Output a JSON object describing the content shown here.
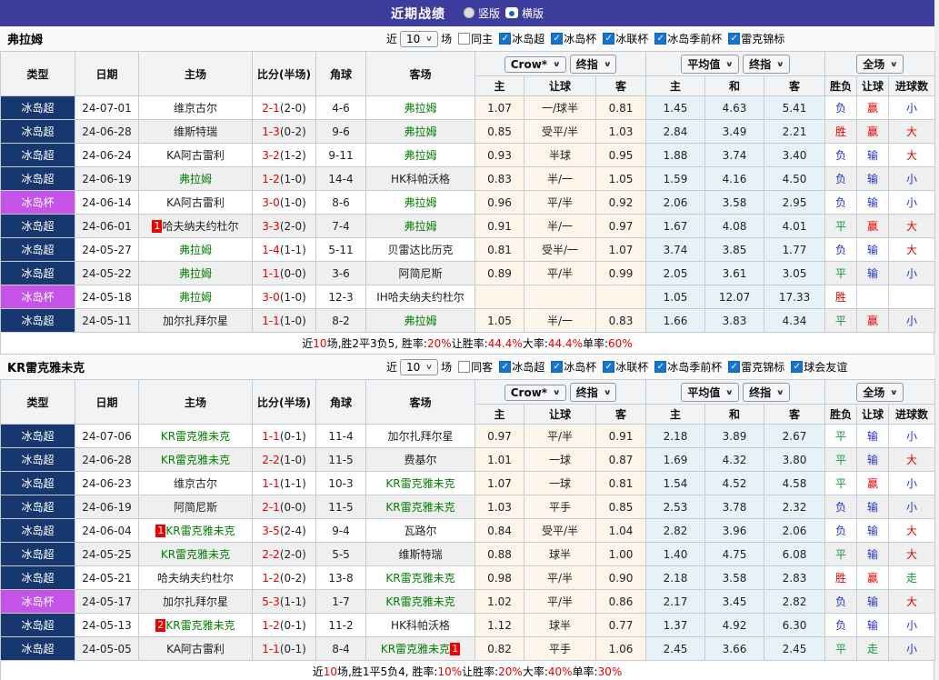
{
  "titlebar": {
    "title": "近期战绩",
    "radios": [
      {
        "label": "竖版",
        "selected": false
      },
      {
        "label": "横版",
        "selected": true
      }
    ]
  },
  "colors": {
    "titlebar_bg": "#3d3d9e",
    "league_super_bg": "#17386e",
    "league_cup_bg": "#c653e8",
    "team_highlight": "#008000",
    "score_red": "#e60000",
    "result_red": "#e60000",
    "result_blue": "#2233cc",
    "result_green": "#0a9a3c",
    "odds_bg": "#fdf5ea",
    "avg_bg": "#e7f2f8",
    "checkbox_blue": "#1673cf"
  },
  "table_headers": {
    "columns": [
      "类型",
      "日期",
      "主场",
      "比分(半场)",
      "角球",
      "客场"
    ],
    "selects": {
      "bookmaker": "Crow*",
      "final_a": "终指",
      "average": "平均值",
      "final_b": "终指",
      "fulltime": "全场"
    },
    "sub_odds": [
      "主",
      "让球",
      "客"
    ],
    "sub_avg": [
      "主",
      "和",
      "客"
    ],
    "sub_result": [
      "胜负",
      "让球",
      "进球数"
    ]
  },
  "sections": [
    {
      "team": "弗拉姆",
      "filter": {
        "prefix": "近",
        "count": "10",
        "suffix": "场",
        "same": {
          "label": "同主",
          "checked": false
        },
        "leagues": [
          {
            "label": "冰岛超",
            "checked": true
          },
          {
            "label": "冰岛杯",
            "checked": true
          },
          {
            "label": "冰联杯",
            "checked": true
          },
          {
            "label": "冰岛季前杯",
            "checked": true
          },
          {
            "label": "雷克锦标",
            "checked": true
          }
        ]
      },
      "rows": [
        {
          "lg": "冰岛超",
          "lgc": "navy",
          "date": "24-07-01",
          "home": "维京古尔",
          "hHL": false,
          "hB": "",
          "ft": "2-1",
          "ht": "(2-0)",
          "cor": "4-6",
          "away": "弗拉姆",
          "aHL": true,
          "aB": "",
          "o1": "1.07",
          "o2": "一/球半",
          "o3": "0.81",
          "a1": "1.45",
          "a2": "4.63",
          "a3": "5.41",
          "r1": [
            "负",
            "blue"
          ],
          "r2": [
            "赢",
            "red"
          ],
          "r3": [
            "小",
            "blue"
          ]
        },
        {
          "lg": "冰岛超",
          "lgc": "navy",
          "date": "24-06-28",
          "home": "维斯特瑞",
          "hHL": false,
          "hB": "",
          "ft": "1-3",
          "ht": "(0-2)",
          "cor": "9-6",
          "away": "弗拉姆",
          "aHL": true,
          "aB": "",
          "o1": "0.85",
          "o2": "受平/半",
          "o3": "1.03",
          "a1": "2.84",
          "a2": "3.49",
          "a3": "2.21",
          "r1": [
            "胜",
            "red"
          ],
          "r2": [
            "赢",
            "red"
          ],
          "r3": [
            "大",
            "red"
          ]
        },
        {
          "lg": "冰岛超",
          "lgc": "navy",
          "date": "24-06-24",
          "home": "KA阿古雷利",
          "hHL": false,
          "hB": "",
          "ft": "3-2",
          "ht": "(1-2)",
          "cor": "9-11",
          "away": "弗拉姆",
          "aHL": true,
          "aB": "",
          "o1": "0.93",
          "o2": "半球",
          "o3": "0.95",
          "a1": "1.88",
          "a2": "3.74",
          "a3": "3.40",
          "r1": [
            "负",
            "blue"
          ],
          "r2": [
            "输",
            "blue"
          ],
          "r3": [
            "大",
            "red"
          ]
        },
        {
          "lg": "冰岛超",
          "lgc": "navy",
          "date": "24-06-19",
          "home": "弗拉姆",
          "hHL": true,
          "hB": "",
          "ft": "1-2",
          "ht": "(1-0)",
          "cor": "14-4",
          "away": "HK科帕沃格",
          "aHL": false,
          "aB": "",
          "o1": "0.83",
          "o2": "半/一",
          "o3": "1.05",
          "a1": "1.59",
          "a2": "4.16",
          "a3": "4.50",
          "r1": [
            "负",
            "blue"
          ],
          "r2": [
            "输",
            "blue"
          ],
          "r3": [
            "小",
            "blue"
          ]
        },
        {
          "lg": "冰岛杯",
          "lgc": "violet",
          "date": "24-06-14",
          "home": "KA阿古雷利",
          "hHL": false,
          "hB": "",
          "ft": "3-0",
          "ht": "(1-0)",
          "cor": "8-6",
          "away": "弗拉姆",
          "aHL": true,
          "aB": "",
          "o1": "0.96",
          "o2": "平/半",
          "o3": "0.92",
          "a1": "2.06",
          "a2": "3.58",
          "a3": "2.95",
          "r1": [
            "负",
            "blue"
          ],
          "r2": [
            "输",
            "blue"
          ],
          "r3": [
            "小",
            "blue"
          ]
        },
        {
          "lg": "冰岛超",
          "lgc": "navy",
          "date": "24-06-01",
          "home": "哈夫纳夫约杜尔",
          "hHL": false,
          "hB": "1",
          "ft": "3-3",
          "ht": "(2-0)",
          "cor": "7-4",
          "away": "弗拉姆",
          "aHL": true,
          "aB": "",
          "o1": "0.91",
          "o2": "半/一",
          "o3": "0.97",
          "a1": "1.67",
          "a2": "4.08",
          "a3": "4.01",
          "r1": [
            "平",
            "green"
          ],
          "r2": [
            "赢",
            "red"
          ],
          "r3": [
            "大",
            "red"
          ]
        },
        {
          "lg": "冰岛超",
          "lgc": "navy",
          "date": "24-05-27",
          "home": "弗拉姆",
          "hHL": true,
          "hB": "",
          "ft": "1-4",
          "ht": "(1-1)",
          "cor": "5-11",
          "away": "贝雷达比历克",
          "aHL": false,
          "aB": "",
          "o1": "0.81",
          "o2": "受半/一",
          "o3": "1.07",
          "a1": "3.74",
          "a2": "3.85",
          "a3": "1.77",
          "r1": [
            "负",
            "blue"
          ],
          "r2": [
            "输",
            "blue"
          ],
          "r3": [
            "大",
            "red"
          ]
        },
        {
          "lg": "冰岛超",
          "lgc": "navy",
          "date": "24-05-22",
          "home": "弗拉姆",
          "hHL": true,
          "hB": "",
          "ft": "1-1",
          "ht": "(0-0)",
          "cor": "3-6",
          "away": "阿简尼斯",
          "aHL": false,
          "aB": "",
          "o1": "0.89",
          "o2": "平/半",
          "o3": "0.99",
          "a1": "2.05",
          "a2": "3.61",
          "a3": "3.05",
          "r1": [
            "平",
            "green"
          ],
          "r2": [
            "输",
            "blue"
          ],
          "r3": [
            "小",
            "blue"
          ]
        },
        {
          "lg": "冰岛杯",
          "lgc": "violet",
          "date": "24-05-18",
          "home": "弗拉姆",
          "hHL": true,
          "hB": "",
          "ft": "3-0",
          "ht": "(1-0)",
          "cor": "12-3",
          "away": "IH哈夫纳夫约杜尔",
          "aHL": false,
          "aB": "",
          "o1": "",
          "o2": "",
          "o3": "",
          "a1": "1.05",
          "a2": "12.07",
          "a3": "17.33",
          "r1": [
            "胜",
            "red"
          ],
          "r2": [
            "",
            ""
          ],
          "r3": [
            "",
            ""
          ]
        },
        {
          "lg": "冰岛超",
          "lgc": "navy",
          "date": "24-05-11",
          "home": "加尔扎拜尔星",
          "hHL": false,
          "hB": "",
          "ft": "1-1",
          "ht": "(1-0)",
          "cor": "8-2",
          "away": "弗拉姆",
          "aHL": true,
          "aB": "",
          "o1": "1.05",
          "o2": "半/一",
          "o3": "0.83",
          "a1": "1.66",
          "a2": "3.83",
          "a3": "4.34",
          "r1": [
            "平",
            "green"
          ],
          "r2": [
            "赢",
            "red"
          ],
          "r3": [
            "小",
            "blue"
          ]
        }
      ],
      "summary": [
        {
          "t": "近",
          "red": false
        },
        {
          "t": "10",
          "red": true
        },
        {
          "t": "场,胜2平3负5, 胜率:",
          "red": false
        },
        {
          "t": "20%",
          "red": true
        },
        {
          "t": " 让胜率:",
          "red": false
        },
        {
          "t": "44.4%",
          "red": true
        },
        {
          "t": " 大率:",
          "red": false
        },
        {
          "t": "44.4%",
          "red": true
        },
        {
          "t": " 单率:",
          "red": false
        },
        {
          "t": "60%",
          "red": true
        }
      ]
    },
    {
      "team": "KR雷克雅未克",
      "filter": {
        "prefix": "近",
        "count": "10",
        "suffix": "场",
        "same": {
          "label": "同客",
          "checked": false
        },
        "leagues": [
          {
            "label": "冰岛超",
            "checked": true
          },
          {
            "label": "冰岛杯",
            "checked": true
          },
          {
            "label": "冰联杯",
            "checked": true
          },
          {
            "label": "冰岛季前杯",
            "checked": true
          },
          {
            "label": "雷克锦标",
            "checked": true
          },
          {
            "label": "球会友谊",
            "checked": true
          }
        ]
      },
      "rows": [
        {
          "lg": "冰岛超",
          "lgc": "navy",
          "date": "24-07-06",
          "home": "KR雷克雅未克",
          "hHL": true,
          "hB": "",
          "ft": "1-1",
          "ht": "(0-1)",
          "cor": "11-4",
          "away": "加尔扎拜尔星",
          "aHL": false,
          "aB": "",
          "o1": "0.97",
          "o2": "平/半",
          "o3": "0.91",
          "a1": "2.18",
          "a2": "3.89",
          "a3": "2.67",
          "r1": [
            "平",
            "green"
          ],
          "r2": [
            "输",
            "blue"
          ],
          "r3": [
            "小",
            "blue"
          ]
        },
        {
          "lg": "冰岛超",
          "lgc": "navy",
          "date": "24-06-28",
          "home": "KR雷克雅未克",
          "hHL": true,
          "hB": "",
          "ft": "2-2",
          "ht": "(1-0)",
          "cor": "11-5",
          "away": "费基尔",
          "aHL": false,
          "aB": "",
          "o1": "1.01",
          "o2": "一球",
          "o3": "0.87",
          "a1": "1.69",
          "a2": "4.32",
          "a3": "3.80",
          "r1": [
            "平",
            "green"
          ],
          "r2": [
            "输",
            "blue"
          ],
          "r3": [
            "大",
            "red"
          ]
        },
        {
          "lg": "冰岛超",
          "lgc": "navy",
          "date": "24-06-23",
          "home": "维京古尔",
          "hHL": false,
          "hB": "",
          "ft": "1-1",
          "ht": "(1-1)",
          "cor": "10-3",
          "away": "KR雷克雅未克",
          "aHL": true,
          "aB": "",
          "o1": "1.07",
          "o2": "一球",
          "o3": "0.81",
          "a1": "1.54",
          "a2": "4.52",
          "a3": "4.58",
          "r1": [
            "平",
            "green"
          ],
          "r2": [
            "赢",
            "red"
          ],
          "r3": [
            "小",
            "blue"
          ]
        },
        {
          "lg": "冰岛超",
          "lgc": "navy",
          "date": "24-06-19",
          "home": "阿简尼斯",
          "hHL": false,
          "hB": "",
          "ft": "2-1",
          "ht": "(0-0)",
          "cor": "11-5",
          "away": "KR雷克雅未克",
          "aHL": true,
          "aB": "",
          "o1": "1.03",
          "o2": "平手",
          "o3": "0.85",
          "a1": "2.53",
          "a2": "3.78",
          "a3": "2.32",
          "r1": [
            "负",
            "blue"
          ],
          "r2": [
            "输",
            "blue"
          ],
          "r3": [
            "小",
            "blue"
          ]
        },
        {
          "lg": "冰岛超",
          "lgc": "navy",
          "date": "24-06-04",
          "home": "KR雷克雅未克",
          "hHL": true,
          "hB": "1",
          "ft": "3-5",
          "ht": "(2-4)",
          "cor": "9-4",
          "away": "瓦路尔",
          "aHL": false,
          "aB": "",
          "o1": "0.84",
          "o2": "受平/半",
          "o3": "1.04",
          "a1": "2.82",
          "a2": "3.96",
          "a3": "2.06",
          "r1": [
            "负",
            "blue"
          ],
          "r2": [
            "输",
            "blue"
          ],
          "r3": [
            "大",
            "red"
          ]
        },
        {
          "lg": "冰岛超",
          "lgc": "navy",
          "date": "24-05-25",
          "home": "KR雷克雅未克",
          "hHL": true,
          "hB": "",
          "ft": "2-2",
          "ht": "(2-0)",
          "cor": "5-5",
          "away": "维斯特瑞",
          "aHL": false,
          "aB": "",
          "o1": "0.88",
          "o2": "球半",
          "o3": "1.00",
          "a1": "1.40",
          "a2": "4.75",
          "a3": "6.08",
          "r1": [
            "平",
            "green"
          ],
          "r2": [
            "输",
            "blue"
          ],
          "r3": [
            "大",
            "red"
          ]
        },
        {
          "lg": "冰岛超",
          "lgc": "navy",
          "date": "24-05-21",
          "home": "哈夫纳夫约杜尔",
          "hHL": false,
          "hB": "",
          "ft": "1-2",
          "ht": "(0-2)",
          "cor": "13-8",
          "away": "KR雷克雅未克",
          "aHL": true,
          "aB": "",
          "o1": "0.98",
          "o2": "平/半",
          "o3": "0.90",
          "a1": "2.18",
          "a2": "3.58",
          "a3": "2.83",
          "r1": [
            "胜",
            "red"
          ],
          "r2": [
            "赢",
            "red"
          ],
          "r3": [
            "走",
            "green"
          ]
        },
        {
          "lg": "冰岛杯",
          "lgc": "violet",
          "date": "24-05-17",
          "home": "加尔扎拜尔星",
          "hHL": false,
          "hB": "",
          "ft": "5-3",
          "ht": "(1-1)",
          "cor": "1-7",
          "away": "KR雷克雅未克",
          "aHL": true,
          "aB": "",
          "o1": "1.02",
          "o2": "平/半",
          "o3": "0.86",
          "a1": "2.17",
          "a2": "3.45",
          "a3": "2.82",
          "r1": [
            "负",
            "blue"
          ],
          "r2": [
            "输",
            "blue"
          ],
          "r3": [
            "大",
            "red"
          ]
        },
        {
          "lg": "冰岛超",
          "lgc": "navy",
          "date": "24-05-13",
          "home": "KR雷克雅未克",
          "hHL": true,
          "hB": "2",
          "ft": "1-2",
          "ht": "(0-1)",
          "cor": "11-2",
          "away": "HK科帕沃格",
          "aHL": false,
          "aB": "",
          "o1": "1.12",
          "o2": "球半",
          "o3": "0.77",
          "a1": "1.37",
          "a2": "4.92",
          "a3": "6.30",
          "r1": [
            "负",
            "blue"
          ],
          "r2": [
            "输",
            "blue"
          ],
          "r3": [
            "小",
            "blue"
          ]
        },
        {
          "lg": "冰岛超",
          "lgc": "navy",
          "date": "24-05-05",
          "home": "KA阿古雷利",
          "hHL": false,
          "hB": "",
          "ft": "1-1",
          "ht": "(0-1)",
          "cor": "8-4",
          "away": "KR雷克雅未克",
          "aHL": true,
          "aB": "1",
          "o1": "0.82",
          "o2": "平手",
          "o3": "1.06",
          "a1": "2.45",
          "a2": "3.66",
          "a3": "2.45",
          "r1": [
            "平",
            "green"
          ],
          "r2": [
            "走",
            "green"
          ],
          "r3": [
            "小",
            "blue"
          ]
        }
      ],
      "summary": [
        {
          "t": "近",
          "red": false
        },
        {
          "t": "10",
          "red": true
        },
        {
          "t": "场,胜1平5负4, 胜率:",
          "red": false
        },
        {
          "t": "10%",
          "red": true
        },
        {
          "t": " 让胜率:",
          "red": false
        },
        {
          "t": "20%",
          "red": true
        },
        {
          "t": " 大率:",
          "red": false
        },
        {
          "t": "40%",
          "red": true
        },
        {
          "t": " 单率:",
          "red": false
        },
        {
          "t": "30%",
          "red": true
        }
      ]
    }
  ]
}
